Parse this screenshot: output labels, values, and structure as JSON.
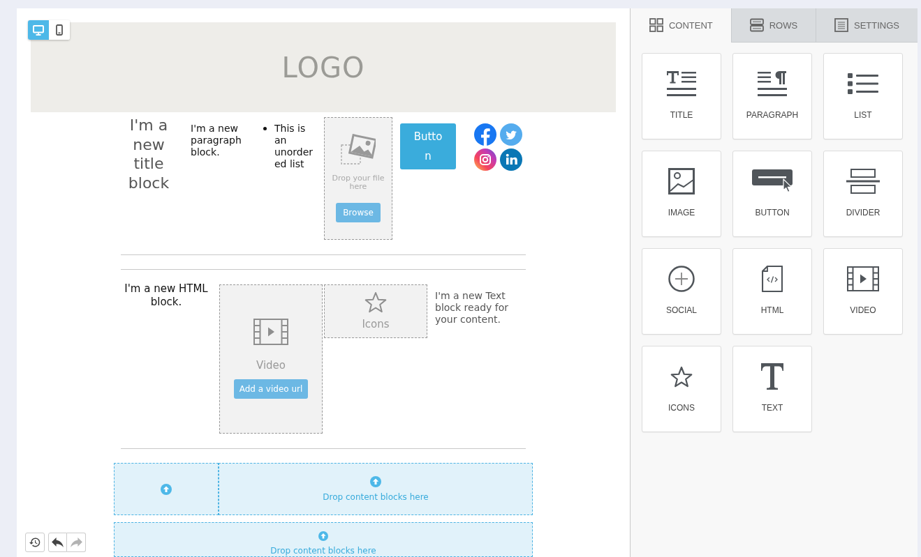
{
  "view_toggle": [
    {
      "kind": "desktop",
      "selected": true
    },
    {
      "kind": "mobile",
      "selected": false
    }
  ],
  "logo": {
    "text": "LOGO"
  },
  "row_1": {
    "title": "I'm a new title block",
    "paragraph": "I'm a new paragraph block.",
    "list": [
      "This is an unordered list"
    ],
    "image_drop": {
      "hint": "Drop your file here",
      "button": "Browse"
    },
    "button": "Button",
    "social": [
      {
        "kind": "facebook"
      },
      {
        "kind": "twitter"
      },
      {
        "kind": "instagram"
      },
      {
        "kind": "linkedin"
      }
    ]
  },
  "row_2": {
    "html": "I'm a new HTML block.",
    "video": {
      "label": "Video",
      "button": "Add a video url"
    },
    "icons": {
      "label": "Icons"
    },
    "text": "I'm a new Text block ready for your content."
  },
  "drop_rows": [
    {
      "cells": [
        {},
        {
          "hint": "Drop content blocks here"
        }
      ]
    },
    {
      "cells": [
        {
          "hint": "Drop content blocks here"
        }
      ]
    }
  ],
  "history_controls": [
    {
      "kind": "history",
      "disabled": false
    },
    {
      "kind": "undo",
      "disabled": false
    },
    {
      "kind": "redo",
      "disabled": true
    }
  ],
  "panel": {
    "tabs": [
      {
        "kind": "content",
        "label": "CONTENT",
        "selected": true
      },
      {
        "kind": "rows",
        "label": "ROWS",
        "selected": false
      },
      {
        "kind": "settings",
        "label": "SETTINGS",
        "selected": false
      }
    ],
    "tiles": [
      {
        "kind": "title",
        "label": "TITLE"
      },
      {
        "kind": "paragraph",
        "label": "PARAGRAPH"
      },
      {
        "kind": "list",
        "label": "LIST"
      },
      {
        "kind": "image",
        "label": "IMAGE"
      },
      {
        "kind": "button",
        "label": "BUTTON"
      },
      {
        "kind": "divider",
        "label": "DIVIDER"
      },
      {
        "kind": "social",
        "label": "SOCIAL"
      },
      {
        "kind": "html",
        "label": "HTML"
      },
      {
        "kind": "video",
        "label": "VIDEO"
      },
      {
        "kind": "icons",
        "label": "ICONS"
      },
      {
        "kind": "text",
        "label": "TEXT"
      }
    ]
  }
}
